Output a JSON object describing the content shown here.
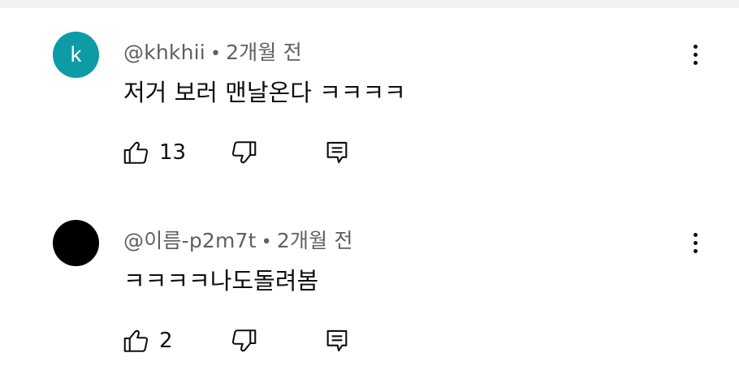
{
  "comments": [
    {
      "avatar_letter": "k",
      "avatar_color": "#0d9ba6",
      "author": "@khkhii",
      "separator": "•",
      "time": "2개월 전",
      "text": "저거 보러 맨날온다 ㅋㅋㅋㅋ",
      "likes": "13",
      "icons": {
        "like": "thumbs-up-icon",
        "dislike": "thumbs-down-icon",
        "reply": "reply-icon",
        "more": "more-vert-icon"
      }
    },
    {
      "avatar_letter": "",
      "avatar_color": "#000000",
      "author": "@이름-p2m7t",
      "separator": "•",
      "time": "2개월 전",
      "text": "ㅋㅋㅋㅋ나도돌려봄",
      "likes": "2",
      "icons": {
        "like": "thumbs-up-icon",
        "dislike": "thumbs-down-icon",
        "reply": "reply-icon",
        "more": "more-vert-icon"
      }
    }
  ]
}
